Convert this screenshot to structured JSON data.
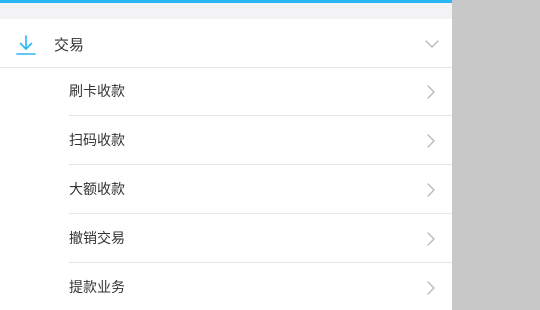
{
  "section": {
    "title": "交易",
    "icon": "download-icon",
    "expand_icon": "chevron-down-icon",
    "accent_color": "#29b6f6",
    "expanded": true
  },
  "items": [
    {
      "label": "刷卡收款",
      "icon": "chevron-right-icon"
    },
    {
      "label": "扫码收款",
      "icon": "chevron-right-icon"
    },
    {
      "label": "大额收款",
      "icon": "chevron-right-icon"
    },
    {
      "label": "撤销交易",
      "icon": "chevron-right-icon"
    },
    {
      "label": "提款业务",
      "icon": "chevron-right-icon"
    }
  ]
}
